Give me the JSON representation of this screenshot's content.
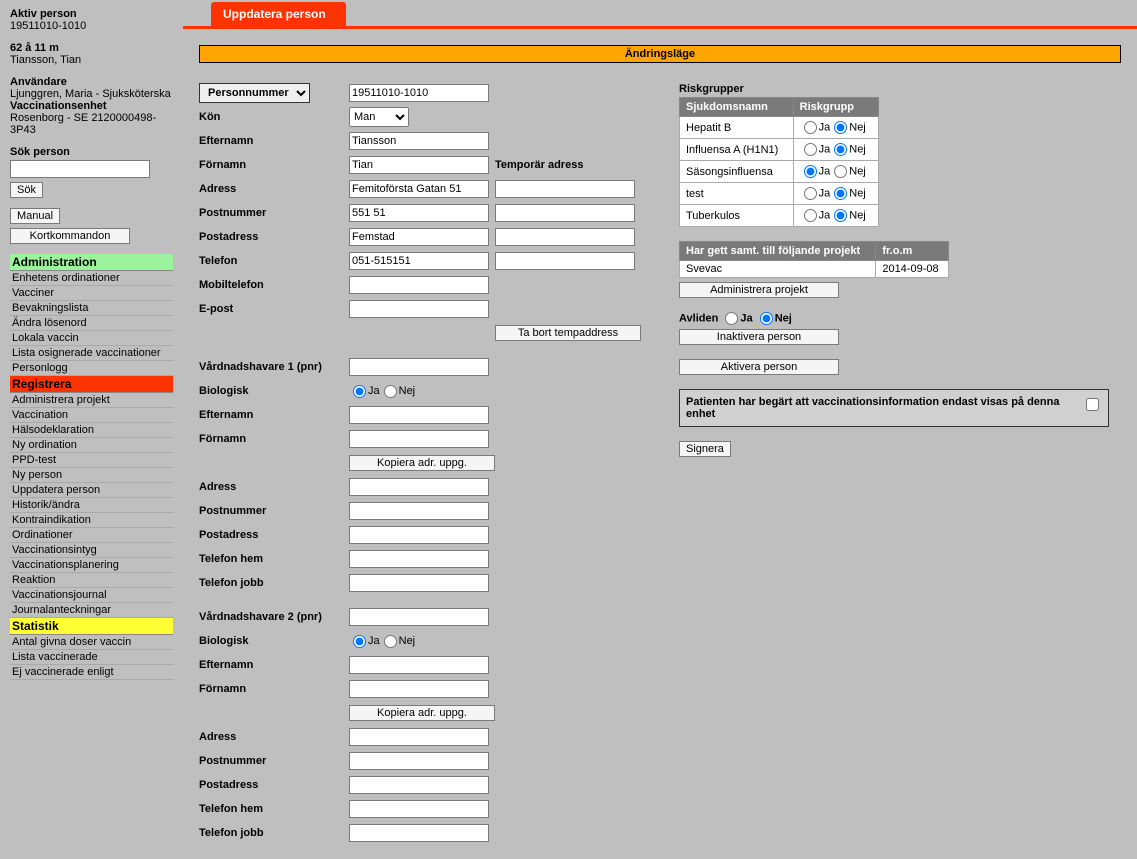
{
  "sidebar": {
    "aktiv_person_label": "Aktiv person",
    "aktiv_person_pnr": "19511010-1010",
    "age_line": "62 å 11 m",
    "name_line": "Tiansson, Tian",
    "anvandare_label": "Användare",
    "anvandare_name": "Ljunggren, Maria - Sjuksköterska",
    "enhet_label": "Vaccinationsenhet",
    "enhet_name": "Rosenborg - SE 2120000498-3P43",
    "sok_label": "Sök person",
    "sok_button": "Sök",
    "manual_button": "Manual",
    "kort_button": "Kortkommandon",
    "menu": {
      "admin_header": "Administration",
      "admin_items": [
        "Enhetens ordinationer",
        "Vacciner",
        "Bevakningslista",
        "Ändra lösenord",
        "Lokala vaccin",
        "Lista osignerade vaccinationer",
        "Personlogg"
      ],
      "reg_header": "Registrera",
      "reg_items": [
        "Administrera projekt",
        "Vaccination",
        "Hälsodeklaration",
        "Ny ordination",
        "PPD-test",
        "Ny person",
        "Uppdatera person",
        "Historik/ändra",
        "Kontraindikation",
        "Ordinationer",
        "Vaccinationsintyg",
        "Vaccinationsplanering",
        "Reaktion",
        "Vaccinationsjournal",
        "Journalanteckningar"
      ],
      "stat_header": "Statistik",
      "stat_items": [
        "Antal givna doser vaccin",
        "Lista vaccinerade",
        "Ej vaccinerade enligt"
      ]
    }
  },
  "tab_label": "Uppdatera person",
  "mode_label": "Ändringsläge",
  "labels": {
    "personnummer": "Personnummer",
    "kon": "Kön",
    "efternamn": "Efternamn",
    "fornamn": "Förnamn",
    "adress": "Adress",
    "postnummer": "Postnummer",
    "postadress": "Postadress",
    "telefon": "Telefon",
    "mobiltelefon": "Mobiltelefon",
    "epost": "E-post",
    "temp_adress": "Temporär adress",
    "ta_bort_temp": "Ta bort tempaddress",
    "vh1": "Vårdnadshavare 1 (pnr)",
    "vh2": "Vårdnadshavare 2 (pnr)",
    "biologisk": "Biologisk",
    "telefon_hem": "Telefon hem",
    "telefon_jobb": "Telefon jobb",
    "kopiera": "Kopiera adr. uppg.",
    "ja": "Ja",
    "nej": "Nej"
  },
  "person": {
    "pnr": "19511010-1010",
    "kon": "Man",
    "efternamn": "Tiansson",
    "fornamn": "Tian",
    "adress": "Femitoförsta Gatan 51",
    "postnummer": "551 51",
    "postadress": "Femstad",
    "telefon": "051-515151"
  },
  "risk": {
    "title": "Riskgrupper",
    "col1": "Sjukdomsnamn",
    "col2": "Riskgrupp",
    "rows": [
      {
        "name": "Hepatit B",
        "val": "Nej"
      },
      {
        "name": "Influensa A (H1N1)",
        "val": "Nej"
      },
      {
        "name": "Säsongsinfluensa",
        "val": "Ja"
      },
      {
        "name": "test",
        "val": "Nej"
      },
      {
        "name": "Tuberkulos",
        "val": "Nej"
      }
    ]
  },
  "proj": {
    "col1": "Har gett samt. till följande projekt",
    "col2": "fr.o.m",
    "row_name": "Svevac",
    "row_date": "2014-09-08",
    "admin_btn": "Administrera projekt"
  },
  "avliden": {
    "label": "Avliden",
    "inaktivera": "Inaktivera person",
    "aktivera": "Aktivera person"
  },
  "infobox": "Patienten har begärt att vaccinationsinformation endast visas på denna enhet",
  "signera": "Signera"
}
